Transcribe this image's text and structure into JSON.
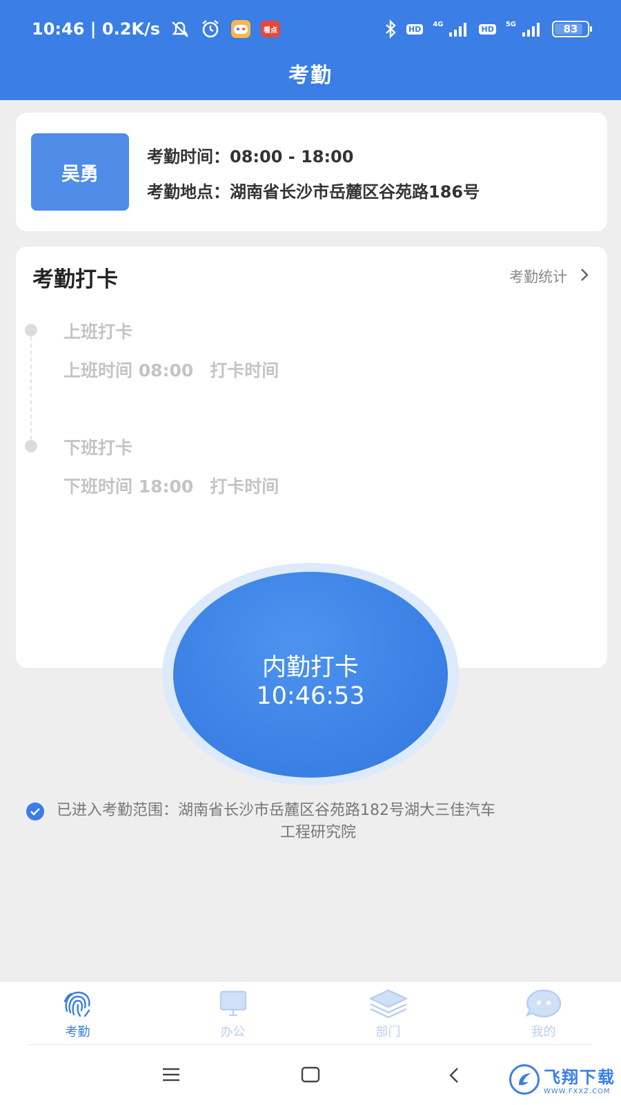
{
  "status_bar": {
    "time_speed": "10:46 | 0.2K/s",
    "app_badge": "看点",
    "hd1": "HD",
    "net1": "4G",
    "hd2": "HD",
    "net2": "5G",
    "battery": "83"
  },
  "header": {
    "title": "考勤"
  },
  "info_card": {
    "name": "吴勇",
    "time_line": "考勤时间：08:00 - 18:00",
    "location_line": "考勤地点：湖南省长沙市岳麓区谷苑路186号"
  },
  "clock_card": {
    "title": "考勤打卡",
    "stats_link": "考勤统计",
    "on_duty": {
      "title": "上班打卡",
      "schedule": "上班时间 08:00",
      "punch_label": "打卡时间"
    },
    "off_duty": {
      "title": "下班打卡",
      "schedule": "下班时间 18:00",
      "punch_label": "打卡时间"
    }
  },
  "punch_button": {
    "label": "内勤打卡",
    "time": "10:46:53"
  },
  "range": {
    "line1": "已进入考勤范围：湖南省长沙市岳麓区谷苑路182号湖大三佳汽车",
    "line2": "工程研究院"
  },
  "tabs": [
    {
      "label": "考勤",
      "icon": "fingerprint-icon",
      "active": true
    },
    {
      "label": "办公",
      "icon": "monitor-icon",
      "active": false
    },
    {
      "label": "部门",
      "icon": "layers-icon",
      "active": false
    },
    {
      "label": "我的",
      "icon": "chat-face-icon",
      "active": false
    }
  ],
  "watermark": {
    "title": "飞翔下载",
    "url": "WWW.FXXZ.COM"
  },
  "colors": {
    "primary": "#3a7ee6",
    "background": "#eeeeee",
    "muted_text": "#c4c4c4"
  }
}
